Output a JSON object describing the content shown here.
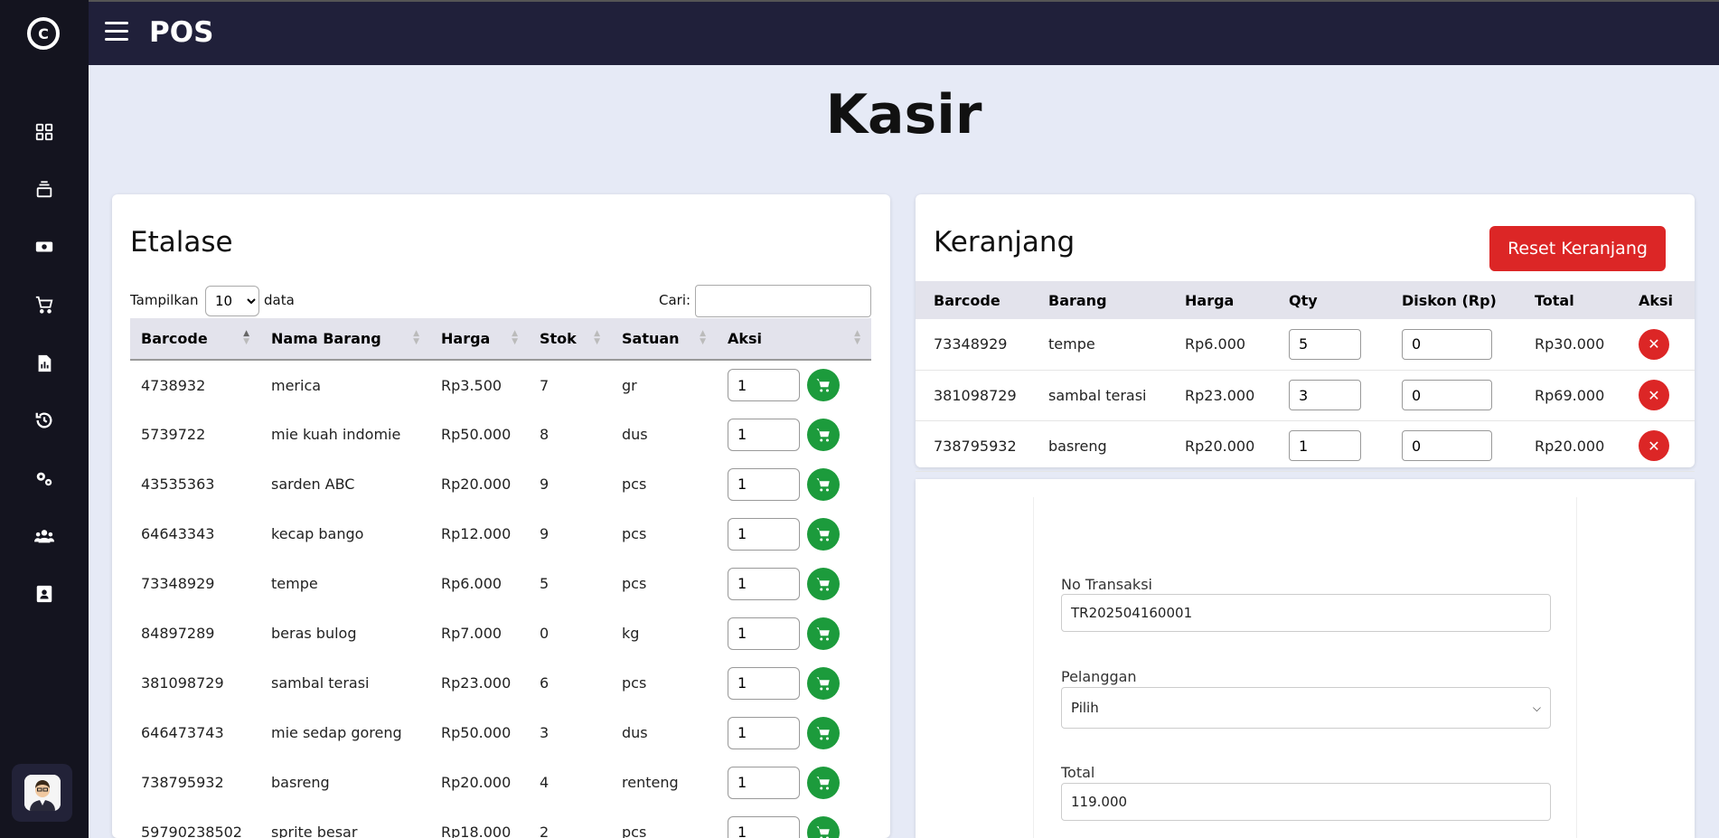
{
  "app": {
    "title": "POS"
  },
  "page": {
    "title": "Kasir"
  },
  "sidebar": {
    "logo": "C",
    "items": [
      {
        "icon": "dashboard-icon"
      },
      {
        "icon": "layers-icon"
      },
      {
        "icon": "money-icon"
      },
      {
        "icon": "cart-icon"
      },
      {
        "icon": "report-icon"
      },
      {
        "icon": "history-icon"
      },
      {
        "icon": "settings-icon"
      },
      {
        "icon": "users-icon"
      },
      {
        "icon": "contact-icon"
      }
    ]
  },
  "etalase": {
    "title": "Etalase",
    "show_label": "Tampilkan",
    "show_value": "10",
    "show_suffix": "data",
    "search_label": "Cari:",
    "search_value": "",
    "columns": [
      "Barcode",
      "Nama Barang",
      "Harga",
      "Stok",
      "Satuan",
      "Aksi"
    ],
    "rows": [
      {
        "barcode": "4738932",
        "nama": "merica",
        "harga": "Rp3.500",
        "stok": "7",
        "satuan": "gr",
        "qty": "1"
      },
      {
        "barcode": "5739722",
        "nama": "mie kuah indomie",
        "harga": "Rp50.000",
        "stok": "8",
        "satuan": "dus",
        "qty": "1"
      },
      {
        "barcode": "43535363",
        "nama": "sarden ABC",
        "harga": "Rp20.000",
        "stok": "9",
        "satuan": "pcs",
        "qty": "1"
      },
      {
        "barcode": "64643343",
        "nama": "kecap bango",
        "harga": "Rp12.000",
        "stok": "9",
        "satuan": "pcs",
        "qty": "1"
      },
      {
        "barcode": "73348929",
        "nama": "tempe",
        "harga": "Rp6.000",
        "stok": "5",
        "satuan": "pcs",
        "qty": "1"
      },
      {
        "barcode": "84897289",
        "nama": "beras bulog",
        "harga": "Rp7.000",
        "stok": "0",
        "satuan": "kg",
        "qty": "1"
      },
      {
        "barcode": "381098729",
        "nama": "sambal terasi",
        "harga": "Rp23.000",
        "stok": "6",
        "satuan": "pcs",
        "qty": "1"
      },
      {
        "barcode": "646473743",
        "nama": "mie sedap goreng",
        "harga": "Rp50.000",
        "stok": "3",
        "satuan": "dus",
        "qty": "1"
      },
      {
        "barcode": "738795932",
        "nama": "basreng",
        "harga": "Rp20.000",
        "stok": "4",
        "satuan": "renteng",
        "qty": "1"
      },
      {
        "barcode": "59790238502",
        "nama": "sprite besar",
        "harga": "Rp18.000",
        "stok": "2",
        "satuan": "pcs",
        "qty": "1"
      }
    ]
  },
  "keranjang": {
    "title": "Keranjang",
    "reset_label": "Reset Keranjang",
    "columns": [
      "Barcode",
      "Barang",
      "Harga",
      "Qty",
      "Diskon (Rp)",
      "Total",
      "Aksi"
    ],
    "rows": [
      {
        "barcode": "73348929",
        "barang": "tempe",
        "harga": "Rp6.000",
        "qty": "5",
        "diskon": "0",
        "total": "Rp30.000"
      },
      {
        "barcode": "381098729",
        "barang": "sambal terasi",
        "harga": "Rp23.000",
        "qty": "3",
        "diskon": "0",
        "total": "Rp69.000"
      },
      {
        "barcode": "738795932",
        "barang": "basreng",
        "harga": "Rp20.000",
        "qty": "1",
        "diskon": "0",
        "total": "Rp20.000"
      }
    ]
  },
  "form": {
    "no_transaksi_label": "No Transaksi",
    "no_transaksi_value": "TR202504160001",
    "pelanggan_label": "Pelanggan",
    "pelanggan_value": "Pilih",
    "total_label": "Total",
    "total_value": "119.000"
  },
  "colors": {
    "accent_green": "#1c9b3c",
    "accent_red": "#dc2626",
    "sidebar": "#14141f",
    "topbar": "#20203a"
  }
}
